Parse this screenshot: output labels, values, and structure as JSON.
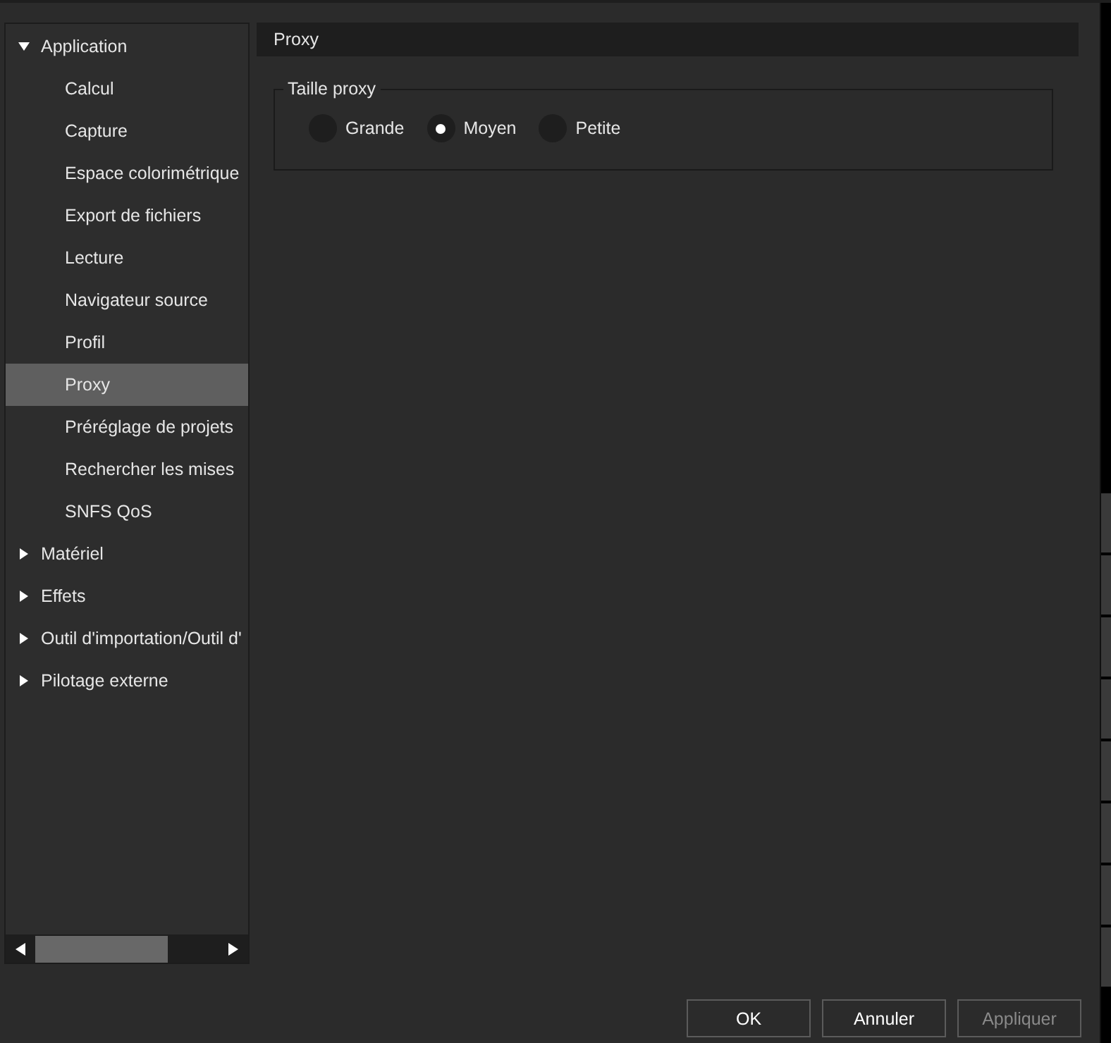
{
  "tree": [
    {
      "label": "Application",
      "expanded": true,
      "selected": false,
      "children": [
        {
          "label": "Calcul",
          "selected": false
        },
        {
          "label": "Capture",
          "selected": false
        },
        {
          "label": "Espace colorimétrique",
          "selected": false
        },
        {
          "label": "Export de fichiers",
          "selected": false
        },
        {
          "label": "Lecture",
          "selected": false
        },
        {
          "label": "Navigateur source",
          "selected": false
        },
        {
          "label": "Profil",
          "selected": false
        },
        {
          "label": "Proxy",
          "selected": true
        },
        {
          "label": "Préréglage de projets",
          "selected": false
        },
        {
          "label": "Rechercher les mises",
          "selected": false
        },
        {
          "label": "SNFS QoS",
          "selected": false
        }
      ]
    },
    {
      "label": "Matériel",
      "expanded": false,
      "selected": false
    },
    {
      "label": "Effets",
      "expanded": false,
      "selected": false
    },
    {
      "label": "Outil d'importation/Outil d'",
      "expanded": false,
      "selected": false
    },
    {
      "label": "Pilotage externe",
      "expanded": false,
      "selected": false
    }
  ],
  "panel": {
    "title": "Proxy",
    "group": {
      "title": "Taille proxy",
      "options": [
        {
          "label": "Grande",
          "selected": false
        },
        {
          "label": "Moyen",
          "selected": true
        },
        {
          "label": "Petite",
          "selected": false
        }
      ]
    }
  },
  "buttons": [
    {
      "label": "OK",
      "disabled": false
    },
    {
      "label": "Annuler",
      "disabled": false
    },
    {
      "label": "Appliquer",
      "disabled": true
    }
  ]
}
